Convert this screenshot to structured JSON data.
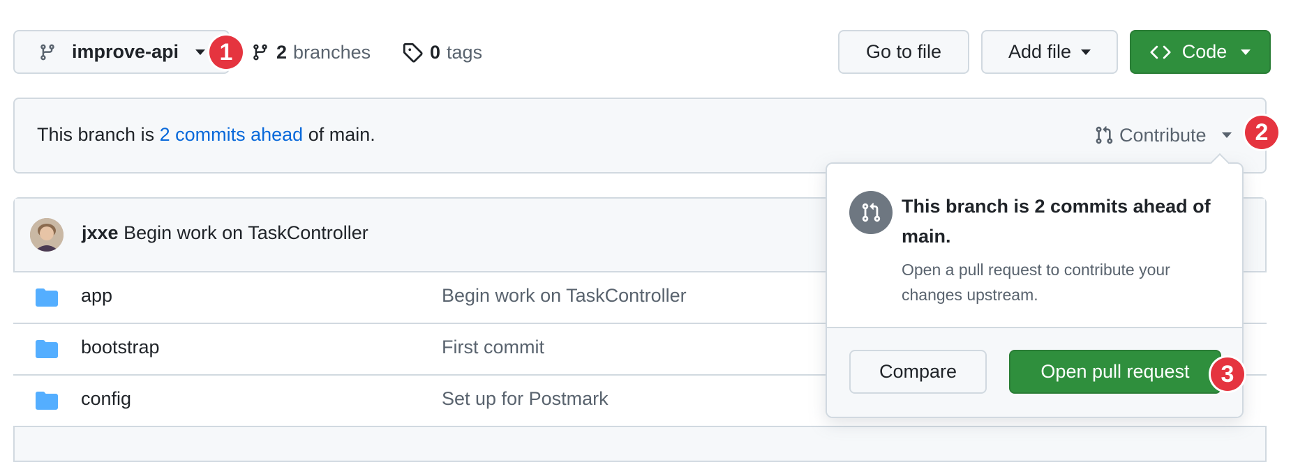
{
  "branch_selector": {
    "branch_name": "improve-api"
  },
  "stats": {
    "branches_count": "2",
    "branches_label": "branches",
    "tags_count": "0",
    "tags_label": "tags"
  },
  "toolbar": {
    "go_to_file_label": "Go to file",
    "add_file_label": "Add file",
    "code_label": "Code"
  },
  "banner": {
    "text_before": "This branch is",
    "link_text": "2 commits ahead",
    "text_after": "of main.",
    "contribute_label": "Contribute"
  },
  "latest_commit": {
    "author": "jxxe",
    "message": "Begin work on TaskController"
  },
  "files": [
    {
      "name": "app",
      "message": "Begin work on TaskController"
    },
    {
      "name": "bootstrap",
      "message": "First commit"
    },
    {
      "name": "config",
      "message": "Set up for Postmark"
    }
  ],
  "popover": {
    "title": "This branch is 2 commits ahead of main.",
    "description": "Open a pull request to contribute your changes upstream.",
    "compare_label": "Compare",
    "open_pr_label": "Open pull request"
  },
  "annotations": {
    "badge_1": "1",
    "badge_2": "2",
    "badge_3": "3"
  },
  "colors": {
    "accent_green": "#2f8f3d",
    "link_blue": "#0969da",
    "badge_red": "#e5343f",
    "folder_blue": "#54aeff",
    "muted_text": "#59636e"
  },
  "icons": {
    "branch": "git-branch-icon",
    "tag": "tag-icon",
    "code": "code-icon",
    "pull_request": "git-pull-request-icon",
    "folder": "folder-icon"
  }
}
